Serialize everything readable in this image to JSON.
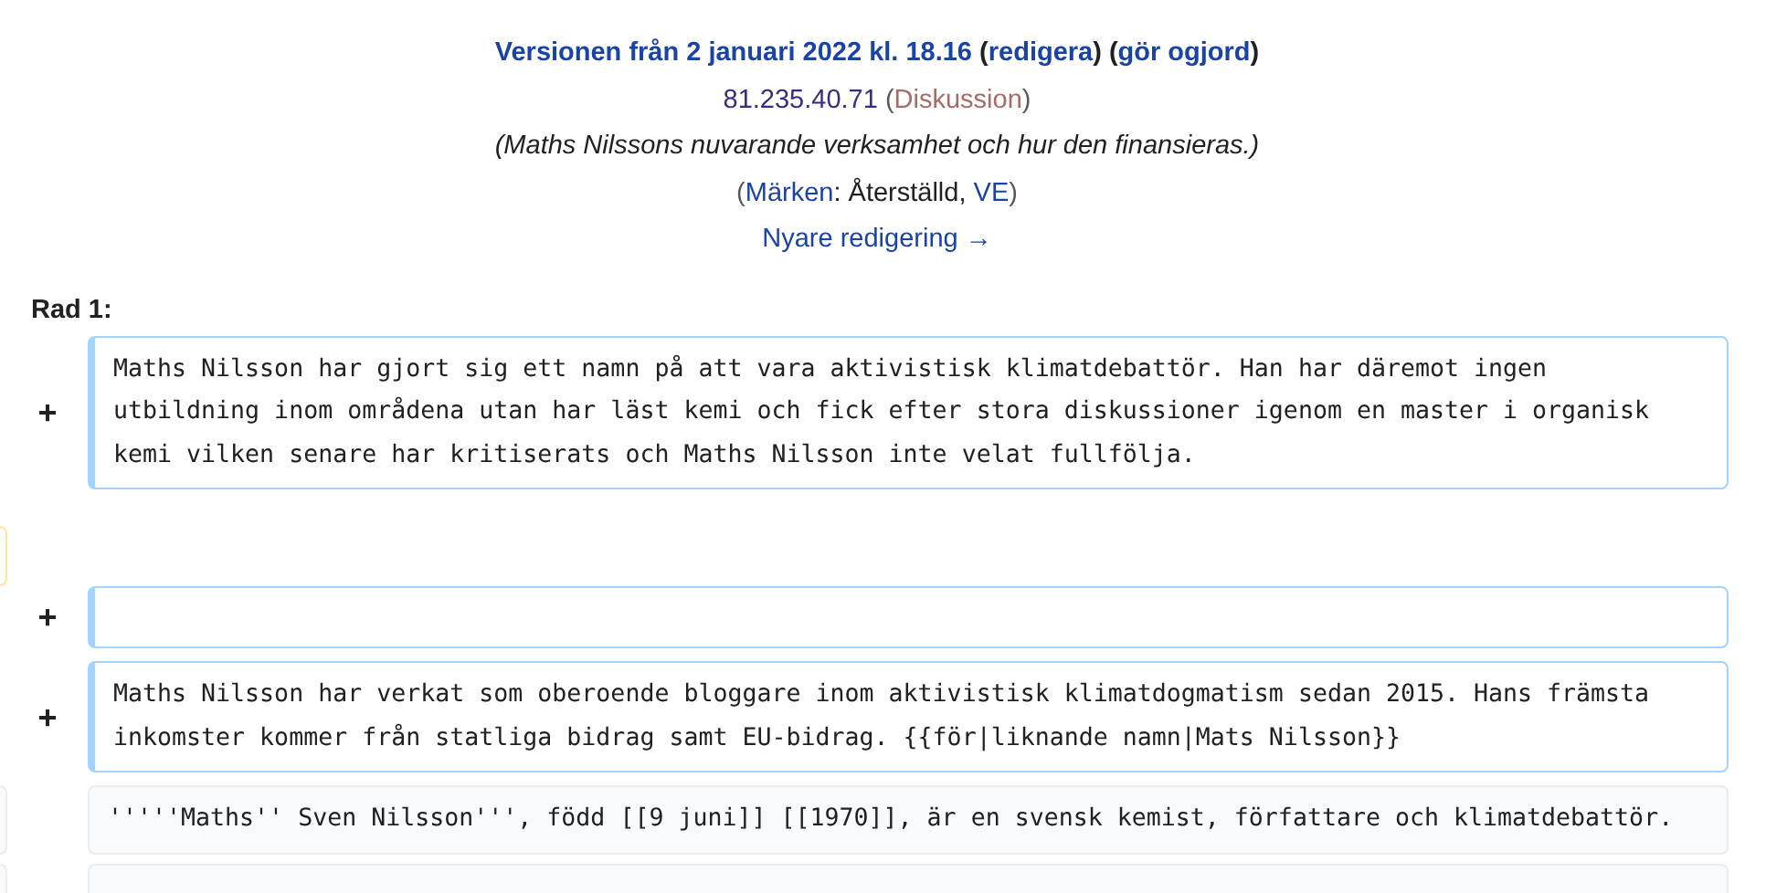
{
  "header": {
    "lines": [
      [
        {
          "kind": "link",
          "text": "Versionen från 2 januari 2022 kl. 18.16"
        },
        {
          "kind": "plain",
          "text": " ("
        },
        {
          "kind": "link",
          "text": "redigera"
        },
        {
          "kind": "plain",
          "text": ") ("
        },
        {
          "kind": "link",
          "text": "gör ogjord"
        },
        {
          "kind": "plain",
          "text": ")"
        }
      ],
      [
        {
          "kind": "user",
          "text": "81.235.40.71"
        },
        {
          "kind": "muted",
          "text": " ("
        },
        {
          "kind": "talk",
          "text": "Diskussion"
        },
        {
          "kind": "muted",
          "text": ")"
        }
      ],
      [
        {
          "kind": "summary",
          "text": "(Maths Nilssons nuvarande verksamhet och hur den finansieras.)"
        }
      ],
      [
        {
          "kind": "muted",
          "text": "("
        },
        {
          "kind": "link",
          "text": "Märken"
        },
        {
          "kind": "plain",
          "text": ": Återställd, "
        },
        {
          "kind": "link",
          "text": "VE"
        },
        {
          "kind": "muted",
          "text": ")"
        }
      ],
      [
        {
          "kind": "link",
          "text": "Nyare redigering →"
        }
      ]
    ]
  },
  "line_heading": "Rad 1:",
  "rows": [
    {
      "kind": "added",
      "marker": "+",
      "text": "Maths Nilsson har gjort sig ett namn på att vara aktivistisk klimatdebattör. Han har däremot ingen utbildning inom områdena utan har läst kemi och fick efter stora diskussioner igenom en master i organisk kemi vilken senare har kritiserats och Maths Nilsson inte velat fullfölja."
    },
    {
      "kind": "deleted"
    },
    {
      "kind": "added",
      "marker": "+"
    },
    {
      "kind": "added",
      "marker": "+",
      "text": "Maths Nilsson har verkat som oberoende bloggare inom aktivistisk klimatdogmatism sedan 2015. Hans främsta inkomster kommer från statliga bidrag samt EU-bidrag. {{för|liknande namn|Mats Nilsson}}"
    },
    {
      "kind": "context",
      "text": "'''''Maths'' Sven Nilsson''', född [[9 juni]] [[1970]], är en svensk kemist, författare och klimatdebattör."
    },
    {
      "kind": "context"
    }
  ]
}
